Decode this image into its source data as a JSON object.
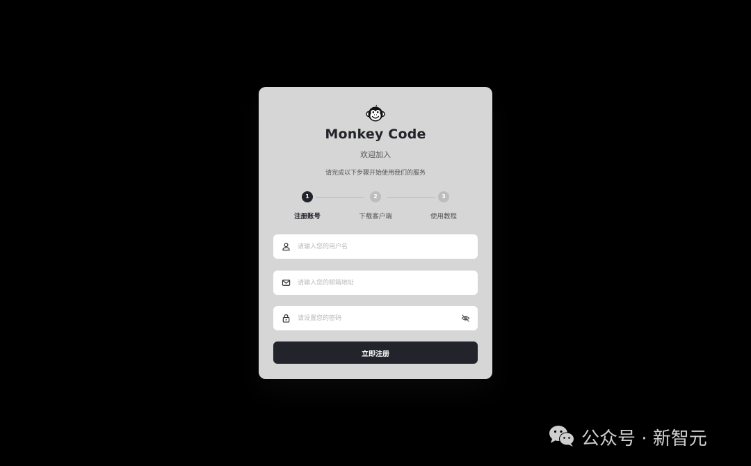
{
  "app": {
    "title": "Monkey Code",
    "welcome": "欢迎加入",
    "subtitle": "请完成以下步骤开始使用我们的服务"
  },
  "steps": [
    {
      "number": "1",
      "label": "注册账号",
      "active": true
    },
    {
      "number": "2",
      "label": "下载客户端",
      "active": false
    },
    {
      "number": "3",
      "label": "使用教程",
      "active": false
    }
  ],
  "form": {
    "username": {
      "value": "",
      "placeholder": "请输入您的用户名",
      "icon": "user-icon"
    },
    "email": {
      "value": "",
      "placeholder": "请输入您的邮箱地址",
      "icon": "mail-icon"
    },
    "password": {
      "value": "",
      "placeholder": "请设置您的密码",
      "icon": "lock-icon",
      "toggle_icon": "eye-off-icon"
    },
    "submit_label": "立即注册"
  },
  "watermark": {
    "text": "公众号 · 新智元",
    "icon": "wechat-icon"
  },
  "colors": {
    "background": "#000000",
    "card": "#d6d6d6",
    "primary": "#22232b",
    "inactive_step": "#bdbdbd"
  }
}
